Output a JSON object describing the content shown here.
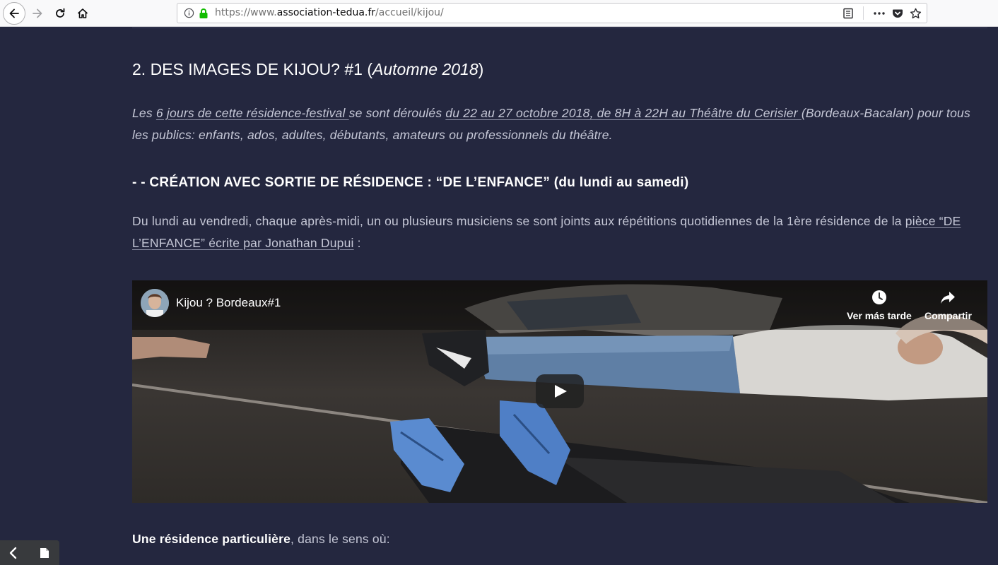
{
  "browser": {
    "url_prefix": "https://www.",
    "url_host": "association-tedua.fr",
    "url_path": "/accueil/kijou/",
    "icons": [
      "back-icon",
      "forward-icon",
      "reload-icon",
      "home-icon",
      "info-icon",
      "lock-icon",
      "reader-view-icon",
      "more-icon",
      "pocket-icon",
      "bookmark-star-icon"
    ]
  },
  "article": {
    "heading_main": "2. DES IMAGES DE KIJOU? #1 (",
    "heading_italic": "Automne 2018",
    "heading_close": ")",
    "intro_1": "Les ",
    "intro_link_1": "6 jours de cette résidence-festival ",
    "intro_2": "se sont déroulés ",
    "intro_link_2": "du 22 au 27 octobre 2018, de 8H à 22H au Théâtre du Cerisier ",
    "intro_3": "(Bordeaux-Bacalan) pour tous les publics: enfants, ados, adultes, débutants, amateurs ou professionnels du théâtre.",
    "subheading": "- - CRÉATION AVEC SORTIE DE RÉSIDENCE : “DE L’ENFANCE” (du lundi au samedi)",
    "para2_text": "Du lundi au vendredi, chaque après-midi, un ou plusieurs musiciens se sont joints aux répétitions quotidiennes de la 1ère résidence de la ",
    "para2_link": "pièce “DE L’ENFANCE” écrite par Jonathan Dupui",
    "para2_end": " :",
    "next_bold": "Une résidence particulière",
    "next_rest": ", dans le sens où:"
  },
  "video": {
    "title": "Kijou ? Bordeaux#1",
    "watch_later_label": "Ver más tarde",
    "share_label": "Compartir",
    "icons": [
      "channel-avatar",
      "clock-icon",
      "share-arrow-icon",
      "play-icon"
    ]
  },
  "dock": {
    "icons": [
      "chevron-left-icon",
      "page-icon"
    ]
  },
  "colors": {
    "page_bg": "#24273f",
    "heading": "#ffffff",
    "body_text": "#c5c7d6",
    "lock_green": "#12bc00"
  }
}
